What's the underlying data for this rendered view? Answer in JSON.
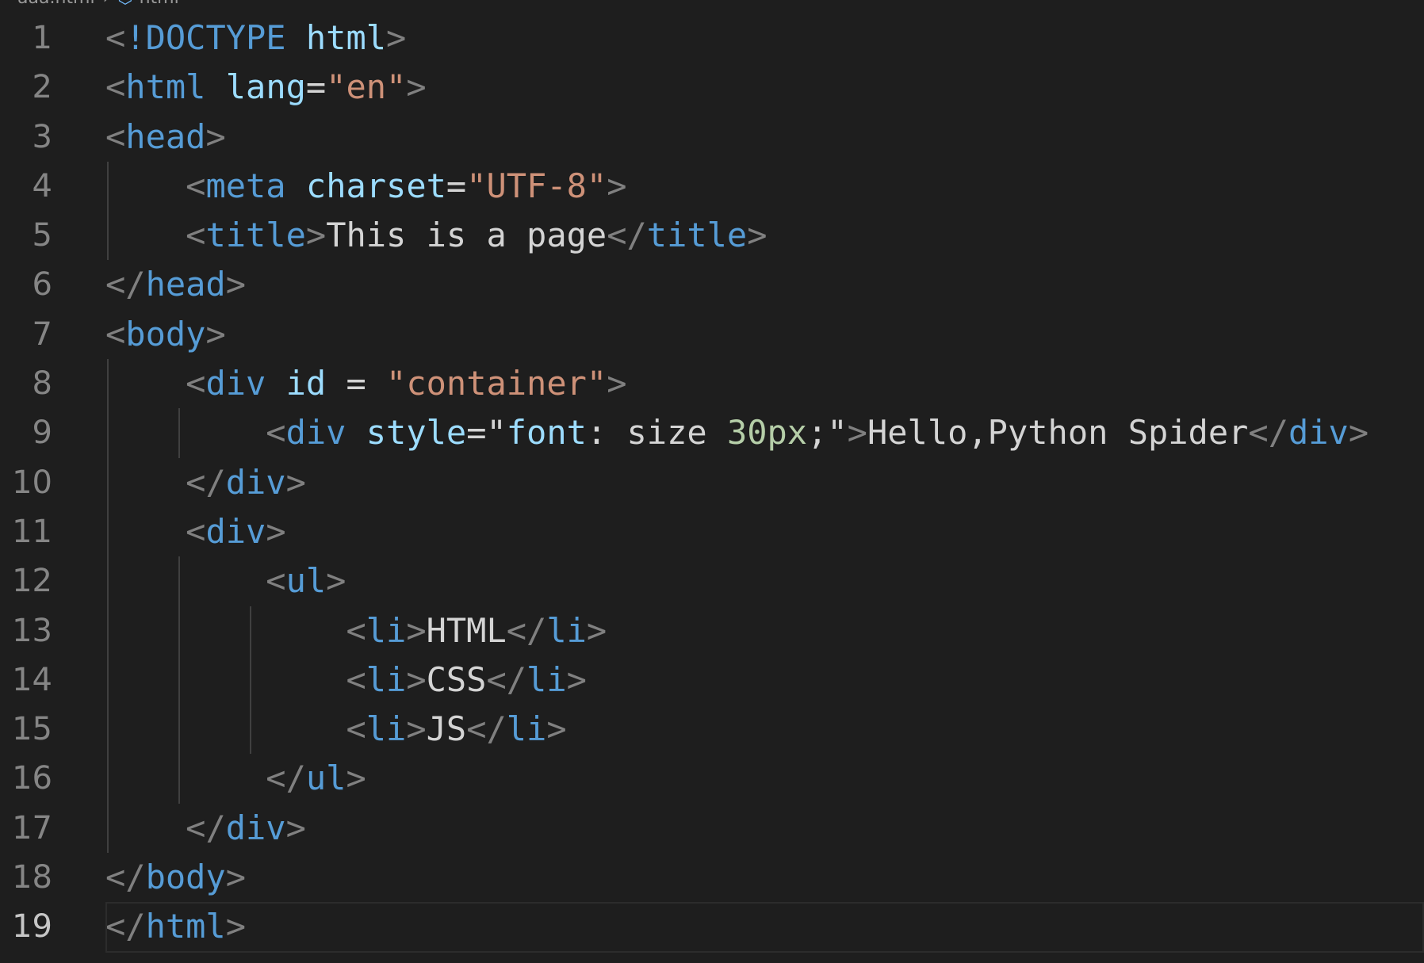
{
  "breadcrumb": {
    "file": "aaa.html",
    "symbol": "html"
  },
  "colors": {
    "background": "#1e1e1e",
    "punctuation": "#808080",
    "tag": "#569cd6",
    "attribute": "#9cdcfe",
    "string": "#ce9178",
    "text": "#d4d4d4",
    "number": "#b5cea8",
    "line_number": "#858585"
  },
  "editor": {
    "current_line": 19,
    "lines": [
      {
        "n": "1",
        "indent": 0,
        "tokens": [
          [
            "t-punc",
            "<"
          ],
          [
            "t-tag",
            "!DOCTYPE"
          ],
          [
            "t-text",
            " "
          ],
          [
            "t-attr",
            "html"
          ],
          [
            "t-punc",
            ">"
          ]
        ]
      },
      {
        "n": "2",
        "indent": 0,
        "tokens": [
          [
            "t-punc",
            "<"
          ],
          [
            "t-tag",
            "html"
          ],
          [
            "t-text",
            " "
          ],
          [
            "t-attr",
            "lang"
          ],
          [
            "t-text",
            "="
          ],
          [
            "t-str",
            "\"en\""
          ],
          [
            "t-punc",
            ">"
          ]
        ]
      },
      {
        "n": "3",
        "indent": 0,
        "tokens": [
          [
            "t-punc",
            "<"
          ],
          [
            "t-tag",
            "head"
          ],
          [
            "t-punc",
            ">"
          ]
        ]
      },
      {
        "n": "4",
        "indent": 1,
        "tokens": [
          [
            "t-text",
            "    "
          ],
          [
            "t-punc",
            "<"
          ],
          [
            "t-tag",
            "meta"
          ],
          [
            "t-text",
            " "
          ],
          [
            "t-attr",
            "charset"
          ],
          [
            "t-text",
            "="
          ],
          [
            "t-str",
            "\"UTF-8\""
          ],
          [
            "t-punc",
            ">"
          ]
        ]
      },
      {
        "n": "5",
        "indent": 1,
        "tokens": [
          [
            "t-text",
            "    "
          ],
          [
            "t-punc",
            "<"
          ],
          [
            "t-tag",
            "title"
          ],
          [
            "t-punc",
            ">"
          ],
          [
            "t-text",
            "This is a page"
          ],
          [
            "t-punc",
            "</"
          ],
          [
            "t-tag",
            "title"
          ],
          [
            "t-punc",
            ">"
          ]
        ]
      },
      {
        "n": "6",
        "indent": 0,
        "tokens": [
          [
            "t-punc",
            "</"
          ],
          [
            "t-tag",
            "head"
          ],
          [
            "t-punc",
            ">"
          ]
        ]
      },
      {
        "n": "7",
        "indent": 0,
        "tokens": [
          [
            "t-punc",
            "<"
          ],
          [
            "t-tag",
            "body"
          ],
          [
            "t-punc",
            ">"
          ]
        ]
      },
      {
        "n": "8",
        "indent": 1,
        "tokens": [
          [
            "t-text",
            "    "
          ],
          [
            "t-punc",
            "<"
          ],
          [
            "t-tag",
            "div"
          ],
          [
            "t-text",
            " "
          ],
          [
            "t-attr",
            "id"
          ],
          [
            "t-text",
            " = "
          ],
          [
            "t-str",
            "\"container\""
          ],
          [
            "t-punc",
            ">"
          ]
        ]
      },
      {
        "n": "9",
        "indent": 2,
        "tokens": [
          [
            "t-text",
            "        "
          ],
          [
            "t-punc",
            "<"
          ],
          [
            "t-tag",
            "div"
          ],
          [
            "t-text",
            " "
          ],
          [
            "t-attr",
            "style"
          ],
          [
            "t-text",
            "=\""
          ],
          [
            "t-attr",
            "font"
          ],
          [
            "t-text",
            ": size "
          ],
          [
            "t-num",
            "30px"
          ],
          [
            "t-text",
            ";\""
          ],
          [
            "t-punc",
            ">"
          ],
          [
            "t-text",
            "Hello,Python Spider"
          ],
          [
            "t-punc",
            "</"
          ],
          [
            "t-tag",
            "div"
          ],
          [
            "t-punc",
            ">"
          ]
        ]
      },
      {
        "n": "10",
        "indent": 1,
        "tokens": [
          [
            "t-text",
            "    "
          ],
          [
            "t-punc",
            "</"
          ],
          [
            "t-tag",
            "div"
          ],
          [
            "t-punc",
            ">"
          ]
        ]
      },
      {
        "n": "11",
        "indent": 1,
        "tokens": [
          [
            "t-text",
            "    "
          ],
          [
            "t-punc",
            "<"
          ],
          [
            "t-tag",
            "div"
          ],
          [
            "t-punc",
            ">"
          ]
        ]
      },
      {
        "n": "12",
        "indent": 2,
        "tokens": [
          [
            "t-text",
            "        "
          ],
          [
            "t-punc",
            "<"
          ],
          [
            "t-tag",
            "ul"
          ],
          [
            "t-punc",
            ">"
          ]
        ]
      },
      {
        "n": "13",
        "indent": 3,
        "tokens": [
          [
            "t-text",
            "            "
          ],
          [
            "t-punc",
            "<"
          ],
          [
            "t-tag",
            "li"
          ],
          [
            "t-punc",
            ">"
          ],
          [
            "t-text",
            "HTML"
          ],
          [
            "t-punc",
            "</"
          ],
          [
            "t-tag",
            "li"
          ],
          [
            "t-punc",
            ">"
          ]
        ]
      },
      {
        "n": "14",
        "indent": 3,
        "tokens": [
          [
            "t-text",
            "            "
          ],
          [
            "t-punc",
            "<"
          ],
          [
            "t-tag",
            "li"
          ],
          [
            "t-punc",
            ">"
          ],
          [
            "t-text",
            "CSS"
          ],
          [
            "t-punc",
            "</"
          ],
          [
            "t-tag",
            "li"
          ],
          [
            "t-punc",
            ">"
          ]
        ]
      },
      {
        "n": "15",
        "indent": 3,
        "tokens": [
          [
            "t-text",
            "            "
          ],
          [
            "t-punc",
            "<"
          ],
          [
            "t-tag",
            "li"
          ],
          [
            "t-punc",
            ">"
          ],
          [
            "t-text",
            "JS"
          ],
          [
            "t-punc",
            "</"
          ],
          [
            "t-tag",
            "li"
          ],
          [
            "t-punc",
            ">"
          ]
        ]
      },
      {
        "n": "16",
        "indent": 2,
        "tokens": [
          [
            "t-text",
            "        "
          ],
          [
            "t-punc",
            "</"
          ],
          [
            "t-tag",
            "ul"
          ],
          [
            "t-punc",
            ">"
          ]
        ]
      },
      {
        "n": "17",
        "indent": 1,
        "tokens": [
          [
            "t-text",
            "    "
          ],
          [
            "t-punc",
            "</"
          ],
          [
            "t-tag",
            "div"
          ],
          [
            "t-punc",
            ">"
          ]
        ]
      },
      {
        "n": "18",
        "indent": 0,
        "tokens": [
          [
            "t-punc",
            "</"
          ],
          [
            "t-tag",
            "body"
          ],
          [
            "t-punc",
            ">"
          ]
        ]
      },
      {
        "n": "19",
        "indent": 0,
        "tokens": [
          [
            "t-punc",
            "</"
          ],
          [
            "t-tag",
            "html"
          ],
          [
            "t-punc",
            ">"
          ]
        ]
      }
    ]
  }
}
